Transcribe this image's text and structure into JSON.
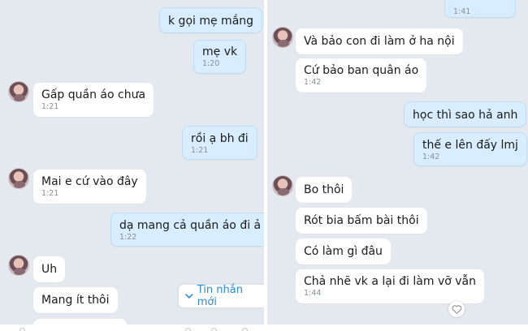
{
  "left_chat": {
    "messages": [
      {
        "text": "k gọi mẹ mắng",
        "time": ""
      },
      {
        "text": "mẹ vk",
        "time": "1:20"
      },
      {
        "text": "Gấp quần áo chưa",
        "time": "1:21"
      },
      {
        "text": "rồi ạ bh đi",
        "time": "1:21"
      },
      {
        "text": "Mai e cứ vào đây",
        "time": "1:21"
      },
      {
        "text": "dạ mang cả quần áo đi ả",
        "time": "1:22"
      },
      {
        "text": "Uh",
        "time": ""
      },
      {
        "text": "Mang ít thôi",
        "time": ""
      }
    ],
    "new_messages_label": "Tin nhắn mới"
  },
  "right_chat": {
    "messages": [
      {
        "text": "",
        "time": "1:41"
      },
      {
        "text": "Và bảo con đi làm ở ha nội",
        "time": ""
      },
      {
        "text": "Cứ bảo ban quân áo",
        "time": "1:42"
      },
      {
        "text": "học thì sao hả anh",
        "time": ""
      },
      {
        "text": "thế e lên đấy lmj",
        "time": "1:42"
      },
      {
        "text": "Bo thôi",
        "time": ""
      },
      {
        "text": "Rót bia bấm bài thôi",
        "time": ""
      },
      {
        "text": "Có làm gì đâu",
        "time": ""
      },
      {
        "text": "Chả nhẽ vk a lại đi làm vỡ vẫn",
        "time": "1:44"
      }
    ]
  },
  "icons": {
    "avatar": "avatar-image",
    "new_messages": "chevron-down-icon",
    "reaction": "heart-icon"
  },
  "colors": {
    "background": "#e4e9ef",
    "incoming_bubble": "#ffffff",
    "outgoing_bubble": "#d8edff",
    "accent": "#2a8bd6"
  }
}
